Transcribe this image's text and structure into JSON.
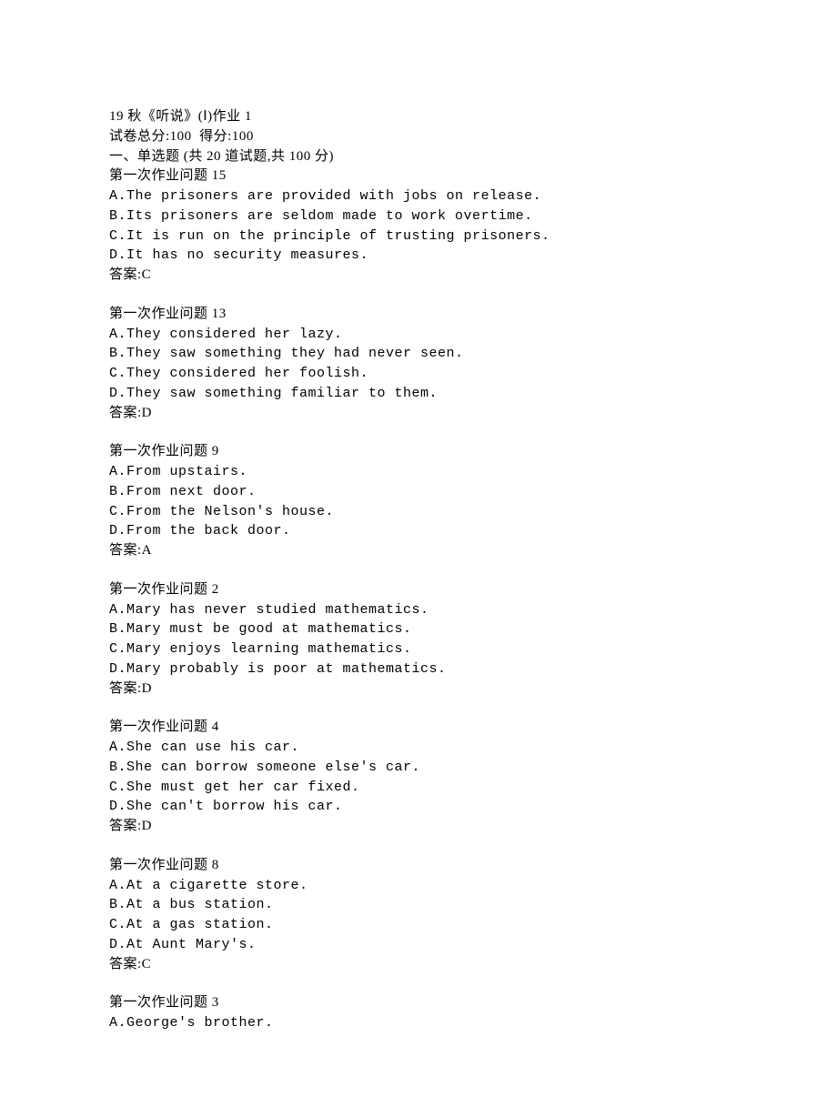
{
  "header": {
    "title": "19 秋《听说》(Ⅰ)作业 1",
    "score_line": "试卷总分:100  得分:100",
    "section": "一、单选题 (共 20 道试题,共 100 分)"
  },
  "questions": [
    {
      "title": "第一次作业问题 15",
      "options": [
        "A.The prisoners are provided with jobs on release.",
        "B.Its prisoners are seldom made to work overtime.",
        "C.It is run on the principle of trusting prisoners.",
        "D.It has no security measures."
      ],
      "answer": "答案:C"
    },
    {
      "title": "第一次作业问题 13",
      "options": [
        "A.They considered her lazy.",
        "B.They saw something they had never seen.",
        "C.They considered her foolish.",
        "D.They saw something familiar to them."
      ],
      "answer": "答案:D"
    },
    {
      "title": "第一次作业问题 9",
      "options": [
        "A.From upstairs.",
        "B.From next door.",
        "C.From the Nelson's house.",
        "D.From the back door."
      ],
      "answer": "答案:A"
    },
    {
      "title": "第一次作业问题 2",
      "options": [
        "A.Mary has never studied mathematics.",
        "B.Mary must be good at mathematics.",
        "C.Mary enjoys learning mathematics.",
        "D.Mary probably is poor at mathematics."
      ],
      "answer": "答案:D"
    },
    {
      "title": "第一次作业问题 4",
      "options": [
        "A.She can use his car.",
        "B.She can borrow someone else's car.",
        "C.She must get her car fixed.",
        "D.She can't borrow his car."
      ],
      "answer": "答案:D"
    },
    {
      "title": "第一次作业问题 8",
      "options": [
        "A.At a cigarette store.",
        "B.At a bus station.",
        "C.At a gas station.",
        "D.At Aunt Mary's."
      ],
      "answer": "答案:C"
    },
    {
      "title": "第一次作业问题 3",
      "options": [
        "A.George's brother."
      ],
      "answer": ""
    }
  ]
}
